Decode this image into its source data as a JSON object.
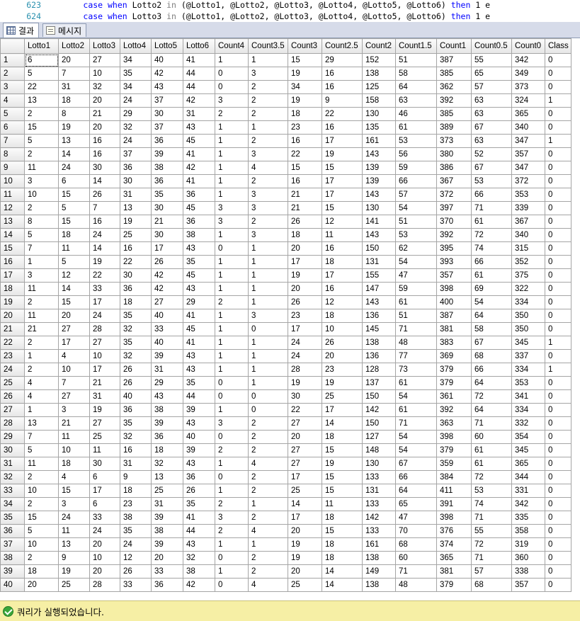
{
  "editor": {
    "lines": [
      {
        "num": "623",
        "parts": [
          {
            "t": "        ",
            "c": ""
          },
          {
            "t": "case when",
            "c": "kw"
          },
          {
            "t": " Lotto2 ",
            "c": ""
          },
          {
            "t": "in",
            "c": "gy"
          },
          {
            "t": " (@Lotto1, @Lotto2, @Lotto3, @Lotto4, @Lotto5, @Lotto6) ",
            "c": ""
          },
          {
            "t": "then",
            "c": "kw"
          },
          {
            "t": " 1 e",
            "c": ""
          }
        ]
      },
      {
        "num": "624",
        "parts": [
          {
            "t": "        ",
            "c": ""
          },
          {
            "t": "case when",
            "c": "kw"
          },
          {
            "t": " Lotto3 ",
            "c": ""
          },
          {
            "t": "in",
            "c": "gy"
          },
          {
            "t": " (@Lotto1, @Lotto2, @Lotto3, @Lotto4, @Lotto5, @Lotto6) ",
            "c": ""
          },
          {
            "t": "then",
            "c": "kw"
          },
          {
            "t": " 1 e",
            "c": ""
          }
        ]
      }
    ]
  },
  "tabs": [
    {
      "label": "결과",
      "icon": "grid-icon",
      "active": true
    },
    {
      "label": "메시지",
      "icon": "message-icon",
      "active": false
    }
  ],
  "grid": {
    "columns": [
      "Lotto1",
      "Lotto2",
      "Lotto3",
      "Lotto4",
      "Lotto5",
      "Lotto6",
      "Count4",
      "Count3.5",
      "Count3",
      "Count2.5",
      "Count2",
      "Count1.5",
      "Count1",
      "Count0.5",
      "Count0",
      "Class"
    ],
    "rows": [
      [
        "6",
        "20",
        "27",
        "34",
        "40",
        "41",
        "1",
        "1",
        "15",
        "29",
        "152",
        "51",
        "387",
        "55",
        "342",
        "0"
      ],
      [
        "5",
        "7",
        "10",
        "35",
        "42",
        "44",
        "0",
        "3",
        "19",
        "16",
        "138",
        "58",
        "385",
        "65",
        "349",
        "0"
      ],
      [
        "22",
        "31",
        "32",
        "34",
        "43",
        "44",
        "0",
        "2",
        "34",
        "16",
        "125",
        "64",
        "362",
        "57",
        "373",
        "0"
      ],
      [
        "13",
        "18",
        "20",
        "24",
        "37",
        "42",
        "3",
        "2",
        "19",
        "9",
        "158",
        "63",
        "392",
        "63",
        "324",
        "1"
      ],
      [
        "2",
        "8",
        "21",
        "29",
        "30",
        "31",
        "2",
        "2",
        "18",
        "22",
        "130",
        "46",
        "385",
        "63",
        "365",
        "0"
      ],
      [
        "15",
        "19",
        "20",
        "32",
        "37",
        "43",
        "1",
        "1",
        "23",
        "16",
        "135",
        "61",
        "389",
        "67",
        "340",
        "0"
      ],
      [
        "5",
        "13",
        "16",
        "24",
        "36",
        "45",
        "1",
        "2",
        "16",
        "17",
        "161",
        "53",
        "373",
        "63",
        "347",
        "1"
      ],
      [
        "2",
        "14",
        "16",
        "37",
        "39",
        "41",
        "1",
        "3",
        "22",
        "19",
        "143",
        "56",
        "380",
        "52",
        "357",
        "0"
      ],
      [
        "11",
        "24",
        "30",
        "36",
        "38",
        "42",
        "1",
        "4",
        "15",
        "15",
        "139",
        "59",
        "386",
        "67",
        "347",
        "0"
      ],
      [
        "3",
        "6",
        "14",
        "30",
        "36",
        "41",
        "1",
        "2",
        "16",
        "17",
        "139",
        "66",
        "367",
        "53",
        "372",
        "0"
      ],
      [
        "10",
        "15",
        "26",
        "31",
        "35",
        "36",
        "1",
        "3",
        "21",
        "17",
        "143",
        "57",
        "372",
        "66",
        "353",
        "0"
      ],
      [
        "2",
        "5",
        "7",
        "13",
        "30",
        "45",
        "3",
        "3",
        "21",
        "15",
        "130",
        "54",
        "397",
        "71",
        "339",
        "0"
      ],
      [
        "8",
        "15",
        "16",
        "19",
        "21",
        "36",
        "3",
        "2",
        "26",
        "12",
        "141",
        "51",
        "370",
        "61",
        "367",
        "0"
      ],
      [
        "5",
        "18",
        "24",
        "25",
        "30",
        "38",
        "1",
        "3",
        "18",
        "11",
        "143",
        "53",
        "392",
        "72",
        "340",
        "0"
      ],
      [
        "7",
        "11",
        "14",
        "16",
        "17",
        "43",
        "0",
        "1",
        "20",
        "16",
        "150",
        "62",
        "395",
        "74",
        "315",
        "0"
      ],
      [
        "1",
        "5",
        "19",
        "22",
        "26",
        "35",
        "1",
        "1",
        "17",
        "18",
        "131",
        "54",
        "393",
        "66",
        "352",
        "0"
      ],
      [
        "3",
        "12",
        "22",
        "30",
        "42",
        "45",
        "1",
        "1",
        "19",
        "17",
        "155",
        "47",
        "357",
        "61",
        "375",
        "0"
      ],
      [
        "11",
        "14",
        "33",
        "36",
        "42",
        "43",
        "1",
        "1",
        "20",
        "16",
        "147",
        "59",
        "398",
        "69",
        "322",
        "0"
      ],
      [
        "2",
        "15",
        "17",
        "18",
        "27",
        "29",
        "2",
        "1",
        "26",
        "12",
        "143",
        "61",
        "400",
        "54",
        "334",
        "0"
      ],
      [
        "11",
        "20",
        "24",
        "35",
        "40",
        "41",
        "1",
        "3",
        "23",
        "18",
        "136",
        "51",
        "387",
        "64",
        "350",
        "0"
      ],
      [
        "21",
        "27",
        "28",
        "32",
        "33",
        "45",
        "1",
        "0",
        "17",
        "10",
        "145",
        "71",
        "381",
        "58",
        "350",
        "0"
      ],
      [
        "2",
        "17",
        "27",
        "35",
        "40",
        "41",
        "1",
        "1",
        "24",
        "26",
        "138",
        "48",
        "383",
        "67",
        "345",
        "1"
      ],
      [
        "1",
        "4",
        "10",
        "32",
        "39",
        "43",
        "1",
        "1",
        "24",
        "20",
        "136",
        "77",
        "369",
        "68",
        "337",
        "0"
      ],
      [
        "2",
        "10",
        "17",
        "26",
        "31",
        "43",
        "1",
        "1",
        "28",
        "23",
        "128",
        "73",
        "379",
        "66",
        "334",
        "1"
      ],
      [
        "4",
        "7",
        "21",
        "26",
        "29",
        "35",
        "0",
        "1",
        "19",
        "19",
        "137",
        "61",
        "379",
        "64",
        "353",
        "0"
      ],
      [
        "4",
        "27",
        "31",
        "40",
        "43",
        "44",
        "0",
        "0",
        "30",
        "25",
        "150",
        "54",
        "361",
        "72",
        "341",
        "0"
      ],
      [
        "1",
        "3",
        "19",
        "36",
        "38",
        "39",
        "1",
        "0",
        "22",
        "17",
        "142",
        "61",
        "392",
        "64",
        "334",
        "0"
      ],
      [
        "13",
        "21",
        "27",
        "35",
        "39",
        "43",
        "3",
        "2",
        "27",
        "14",
        "150",
        "71",
        "363",
        "71",
        "332",
        "0"
      ],
      [
        "7",
        "11",
        "25",
        "32",
        "36",
        "40",
        "0",
        "2",
        "20",
        "18",
        "127",
        "54",
        "398",
        "60",
        "354",
        "0"
      ],
      [
        "5",
        "10",
        "11",
        "16",
        "18",
        "39",
        "2",
        "2",
        "27",
        "15",
        "148",
        "54",
        "379",
        "61",
        "345",
        "0"
      ],
      [
        "11",
        "18",
        "30",
        "31",
        "32",
        "43",
        "1",
        "4",
        "27",
        "19",
        "130",
        "67",
        "359",
        "61",
        "365",
        "0"
      ],
      [
        "2",
        "4",
        "6",
        "9",
        "13",
        "36",
        "0",
        "2",
        "17",
        "15",
        "133",
        "66",
        "384",
        "72",
        "344",
        "0"
      ],
      [
        "10",
        "15",
        "17",
        "18",
        "25",
        "26",
        "1",
        "2",
        "25",
        "15",
        "131",
        "64",
        "411",
        "53",
        "331",
        "0"
      ],
      [
        "2",
        "3",
        "6",
        "23",
        "31",
        "35",
        "2",
        "1",
        "14",
        "11",
        "133",
        "65",
        "391",
        "74",
        "342",
        "0"
      ],
      [
        "15",
        "24",
        "33",
        "38",
        "39",
        "41",
        "3",
        "2",
        "17",
        "18",
        "142",
        "47",
        "398",
        "71",
        "335",
        "0"
      ],
      [
        "5",
        "11",
        "24",
        "35",
        "38",
        "44",
        "2",
        "4",
        "20",
        "15",
        "133",
        "70",
        "376",
        "55",
        "358",
        "0"
      ],
      [
        "10",
        "13",
        "20",
        "24",
        "39",
        "43",
        "1",
        "1",
        "19",
        "18",
        "161",
        "68",
        "374",
        "72",
        "319",
        "0"
      ],
      [
        "2",
        "9",
        "10",
        "12",
        "20",
        "32",
        "0",
        "2",
        "19",
        "18",
        "138",
        "60",
        "365",
        "71",
        "360",
        "0"
      ],
      [
        "18",
        "19",
        "20",
        "26",
        "33",
        "38",
        "1",
        "2",
        "20",
        "14",
        "149",
        "71",
        "381",
        "57",
        "338",
        "0"
      ],
      [
        "20",
        "25",
        "28",
        "33",
        "36",
        "42",
        "0",
        "4",
        "25",
        "14",
        "138",
        "48",
        "379",
        "68",
        "357",
        "0"
      ]
    ]
  },
  "status": {
    "message": "쿼리가 실행되었습니다.",
    "icon": "check-circle-icon",
    "background": "#f6efa5"
  }
}
